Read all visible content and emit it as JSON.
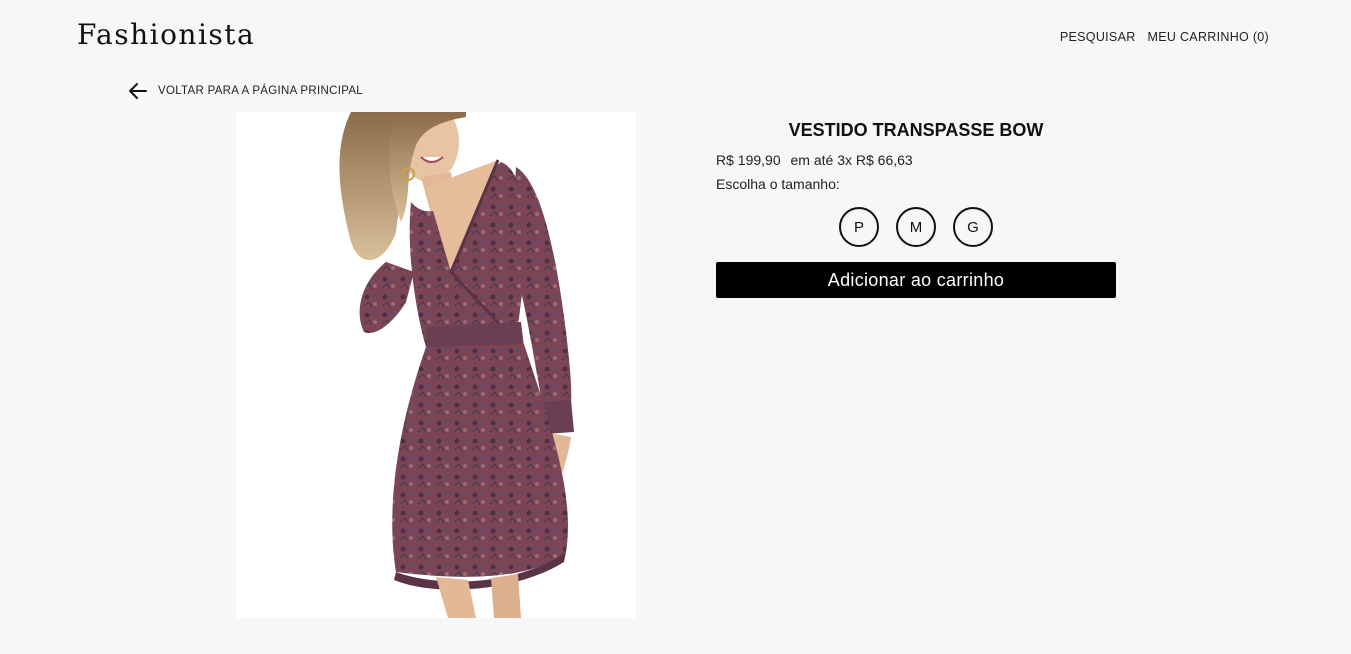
{
  "header": {
    "logo": "Fashionista",
    "nav": {
      "search_label": "PESQUISAR",
      "cart_label": "MEU CARRINHO (0)"
    }
  },
  "back_link": {
    "icon": "arrow-left-icon",
    "label": "VOLTAR PARA A PÁGINA PRINCIPAL"
  },
  "product": {
    "image": "product-photo",
    "title": "VESTIDO TRANSPASSE BOW",
    "price": "R$ 199,90",
    "installments": "em até 3x R$ 66,63",
    "size_prompt": "Escolha o tamanho:",
    "sizes": [
      "P",
      "M",
      "G"
    ],
    "add_to_cart_label": "Adicionar ao carrinho"
  },
  "colors": {
    "background": "#f7f7f7",
    "button": "#000000",
    "button_text": "#ffffff",
    "dress_base": "#7b4556",
    "dress_pattern": "#5a3446"
  }
}
